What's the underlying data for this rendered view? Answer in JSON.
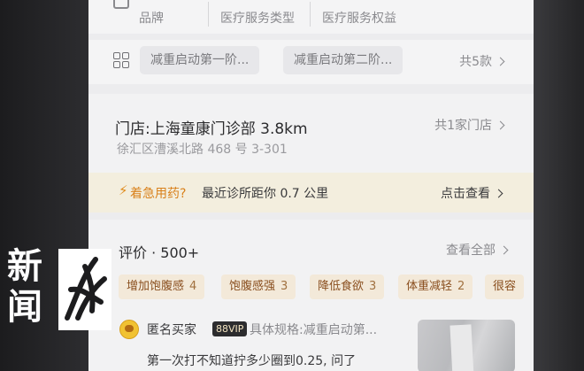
{
  "service_tabs": [
    "品牌",
    "医疗服务类型",
    "医疗服务权益"
  ],
  "specs": {
    "chips": [
      "减重启动第一阶...",
      "减重启动第二阶..."
    ],
    "more": "共5款"
  },
  "store": {
    "title": "门店:上海童康门诊部 3.8km",
    "address": "徐汇区漕溪北路 468 号 3-301",
    "count": "共1家门店"
  },
  "urgent": {
    "icon": "lightning-icon",
    "label": "着急用药?",
    "text": "最近诊所距你 0.7 公里",
    "action": "点击查看"
  },
  "reviews": {
    "title": "评价 · 500+",
    "view_all": "查看全部",
    "tags": [
      {
        "label": "增加饱腹感",
        "count": "4"
      },
      {
        "label": "饱腹感强",
        "count": "3"
      },
      {
        "label": "降低食欲",
        "count": "3"
      },
      {
        "label": "体重减轻",
        "count": "2"
      },
      {
        "label": "很容",
        "count": ""
      }
    ],
    "first": {
      "reviewer": "匿名买家",
      "badge": "88VIP",
      "spec": "具体规格:减重启动第...",
      "text": "第一次打不知道拧多少圈到0.25, 问了"
    }
  },
  "watermark": {
    "text": "新闻",
    "color": "#ffffff"
  }
}
